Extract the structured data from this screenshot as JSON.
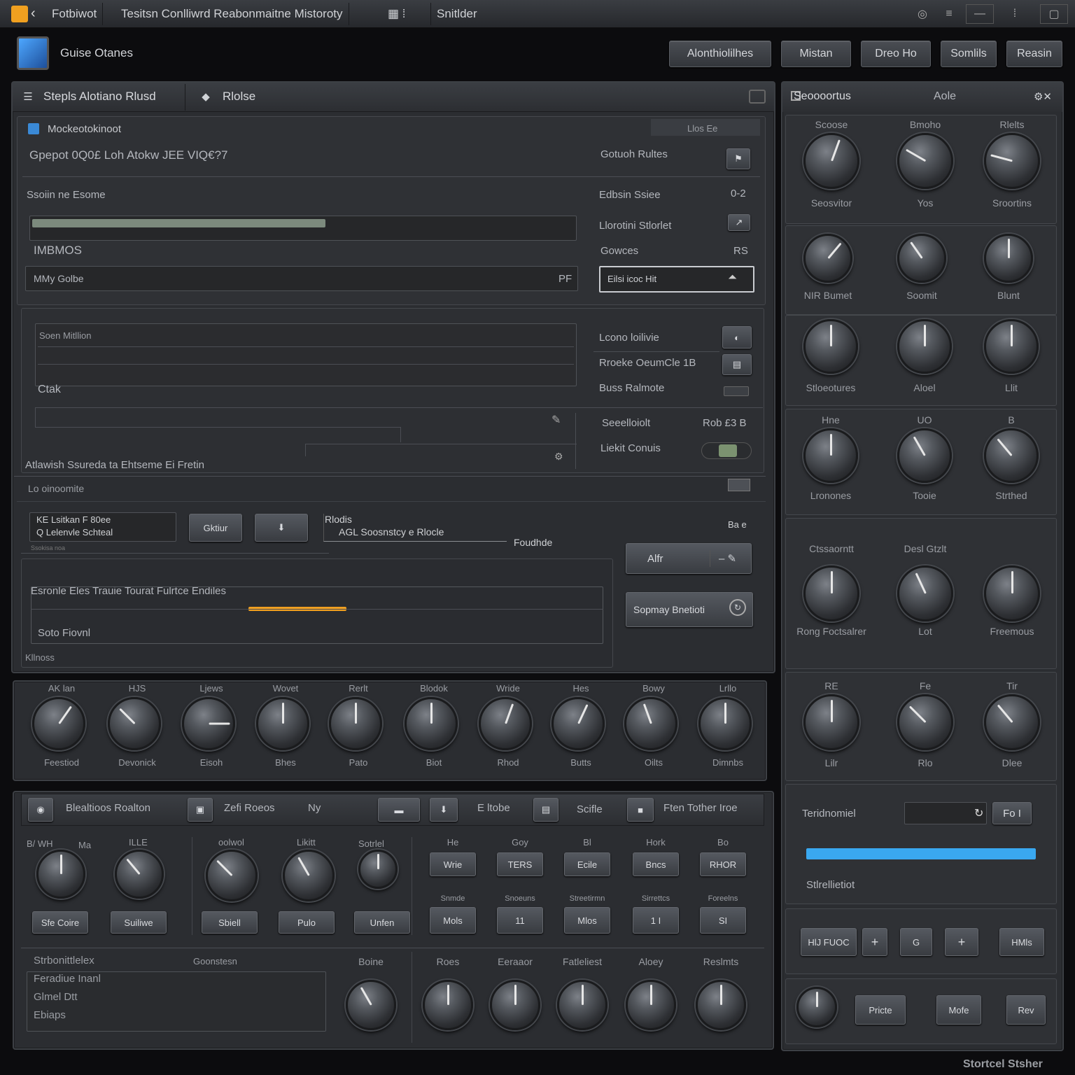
{
  "titlebar": {
    "app": "Fotbiwot",
    "title": "Tesitsn Conlliwrd Reabonmaitne Mistoroty",
    "tab": "Snitlder"
  },
  "header": {
    "logo_label": "Guise Otanes",
    "buttons": [
      "Alonthiolilhes",
      "Mistan",
      "Dreo Ho",
      "Somlils",
      "Reasin"
    ]
  },
  "left_panel": {
    "tabs": [
      "Stepls Alotiano Rlusd",
      "Rlolse"
    ],
    "section1": {
      "title": "Mockeotokinoot",
      "status": "Llos Ee",
      "info": "Gpepot 0Q0£ Loh Atokw JEE VIQ€?7",
      "right_label": "Gotuoh Rultes",
      "progress_label": "Ssoiin ne Esome",
      "progress_pct": 54,
      "mid_label": "IMBMOS",
      "field_value": "MMy Golbe",
      "field_suffix": "PF",
      "rows": [
        {
          "label": "Edbsin Ssiee",
          "value": "0-2"
        },
        {
          "label": "Llorotini Stlorlet",
          "value": ""
        },
        {
          "label": "Gowces",
          "value": "RS"
        }
      ],
      "select_value": "Eilsi icoc Hit"
    },
    "section2": {
      "list_title": "Soen Mitllion",
      "list_item": "Ctak",
      "caption": "Atlawish Ssureda ta Ehtseme Ei Fretin",
      "rows": [
        "Lcono loilivie",
        "Rroeke OeumCle 1B",
        "Buss Ralmote"
      ],
      "row4_label": "Seeelloiolt",
      "row4_value": "Rob £3 B",
      "row5_label": "Liekit Conuis"
    },
    "section3": {
      "title": "Lo oinoomite",
      "mini_list": [
        "KE  Lsitkan  F 80ee",
        "Q  Lelenvle Schteal"
      ],
      "mini_caption": "Ssokisa noa",
      "btn1": "Gktiur",
      "node_title": "Rlodis",
      "node_sub": "AGL Soosnstcy e Rlocle",
      "node_arrow": "Foudhde",
      "node_value": "Ba e",
      "alt_btn": "Alfr",
      "progress_label": "Esronle Eles Trauie Tourat Fulrtce Endiles",
      "progress_pct": 18,
      "field_text": "Soto Fiovnl",
      "footer": "Kllnoss",
      "spray_btn": "Sopmay Bnetioti"
    },
    "knob_row": {
      "top": [
        "AK lan",
        "HJS",
        "Ljews",
        "Wovet",
        "Rerlt",
        "Blodok",
        "Wride",
        "Hes",
        "Bowy",
        "Lrllo"
      ],
      "bottom": [
        "Feestiod",
        "Devonick",
        "Eisoh",
        "Bhes",
        "Pato",
        "Biot",
        "Rhod",
        "Butts",
        "Oilts",
        "Dimnbs"
      ],
      "angles": [
        35,
        -45,
        90,
        0,
        0,
        0,
        20,
        25,
        -20,
        0
      ]
    }
  },
  "bottom_panel": {
    "tabs": [
      "Blealtioos Roalton",
      "Zefi Roeos",
      "Ny",
      "E ltobe",
      "Scifle",
      "Ften Tother Iroe"
    ],
    "left_knobs": {
      "labels": [
        "B/  WH",
        "Ma",
        "ILLE",
        "oolwol",
        "Likitt",
        "Sotrlel"
      ],
      "angles": [
        0,
        -40,
        -45,
        -30,
        0
      ],
      "buttons": [
        "Sfe Coire",
        "Suiliwe",
        "Sbiell",
        "Pulo",
        "Unfen"
      ]
    },
    "grid": {
      "header": [
        "He",
        "Goy",
        "Bl",
        "Hork",
        "Bo"
      ],
      "row1": [
        "Wrie",
        "TERS",
        "Ecile",
        "Bncs",
        "RHOR"
      ],
      "mid": [
        "Snmde",
        "Snoeuns",
        "Streetirmn",
        "Sirrettcs",
        "Foreelns"
      ],
      "row2": [
        "Mols",
        "11",
        "Mlos",
        "1 I",
        "SI"
      ]
    },
    "footer_list": [
      "Strbonittlelex",
      "Feradiue Inanl",
      "Glmel Dtt",
      "Ebiaps"
    ],
    "footer_caption": "Goonstesn",
    "footer_knobs": {
      "labels": [
        "Boine",
        "Roes",
        "Eeraaor",
        "Fatleliest",
        "Aloey",
        "Reslmts"
      ],
      "angles": [
        -30,
        0,
        0,
        0,
        0,
        0
      ]
    }
  },
  "right_panel": {
    "title": "Seoooortus",
    "aux": "Aole",
    "knob_groups": [
      {
        "top": [
          "Scoose",
          "Bmoho",
          "Rlelts"
        ],
        "bottom": [
          "Seosvitor",
          "Yos",
          "Sroortins"
        ],
        "angles": [
          20,
          -60,
          -75
        ]
      },
      {
        "top": [
          "",
          "",
          ""
        ],
        "bottom": [
          "NIR Bumet",
          "Soomit",
          "Blunt"
        ],
        "angles": [
          40,
          -35,
          0
        ]
      },
      {
        "top": [
          "",
          "",
          ""
        ],
        "bottom": [
          "Stloeotures",
          "Aloel",
          "Llit"
        ],
        "angles": [
          0,
          0,
          0
        ]
      },
      {
        "top": [
          "Hne",
          "UO",
          "B"
        ],
        "bottom": [
          "Lronones",
          "Tooie",
          "Strthed"
        ],
        "angles": [
          0,
          -30,
          -40
        ]
      },
      {
        "top": [
          "Ctssaorntt",
          "Desl Gtzlt",
          ""
        ],
        "bottom": [
          "Rong  Foctsalrer",
          "Lot",
          "Freemous"
        ],
        "angles": [
          0,
          -25,
          0
        ]
      },
      {
        "top": [
          "RE",
          "Fe",
          "Tir"
        ],
        "bottom": [
          "Lilr",
          "Rlo",
          "Dlee"
        ],
        "angles": [
          0,
          -45,
          -40
        ]
      }
    ],
    "tone": {
      "label": "Teridnomiel",
      "btn": "Fo I",
      "slider_pct": 100,
      "caption": "Stlrellietiot"
    },
    "transport": [
      "HlJ FUOC",
      "+",
      "G",
      "+",
      "HMls"
    ],
    "bottom_btns": [
      "Pricte",
      "Mofe",
      "Rev"
    ]
  },
  "footer_brand": "Stortcel Stsher"
}
